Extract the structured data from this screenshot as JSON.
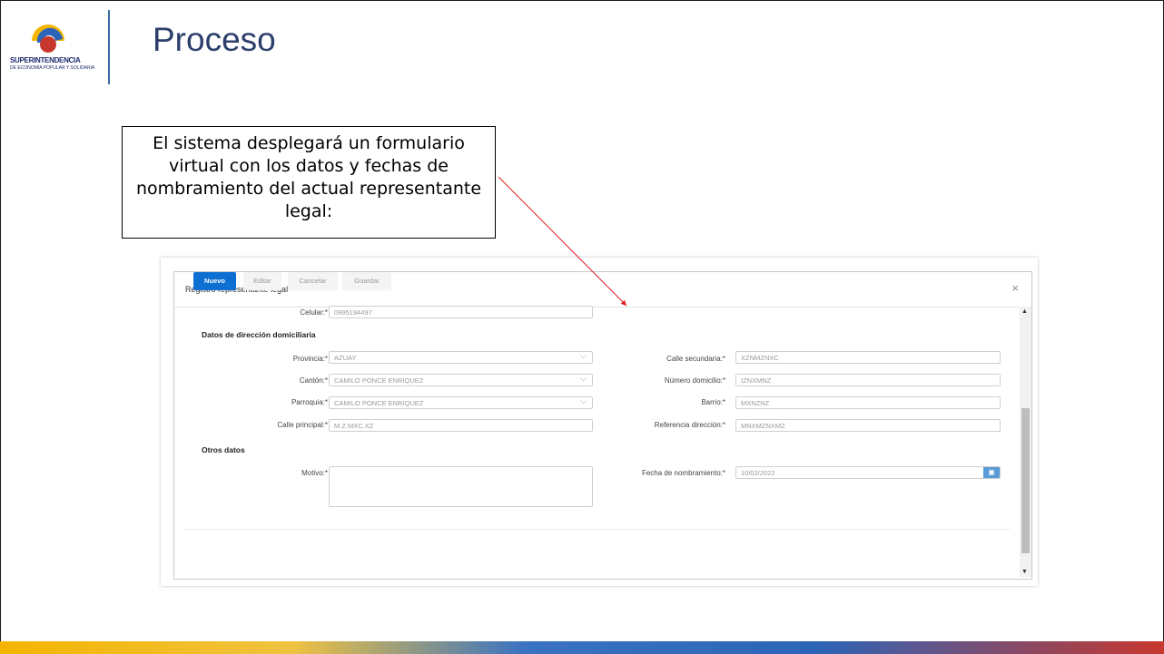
{
  "logo": {
    "text": "SUPERINTENDENCIA",
    "subtext": "DE ECONOMÍA POPULAR Y SOLIDARIA"
  },
  "slide": {
    "title": "Proceso",
    "callout": "El sistema desplegará un formulario virtual con los datos y fechas de nombramiento del actual representante legal:"
  },
  "modal": {
    "title": "Registro representante legal",
    "close": "×",
    "fields": {
      "celular_label": "Celular:*",
      "celular_value": "0995194497",
      "section_direccion": "Datos de dirección domiciliaria",
      "provincia_label": "Provincia:*",
      "provincia_value": "AZUAY",
      "canton_label": "Cantón:*",
      "canton_value": "CAMILO PONCE ENRIQUEZ",
      "parroquia_label": "Parroquia:*",
      "parroquia_value": "CAMILO PONCE ENRIQUEZ",
      "calle_principal_label": "Calle principal:*",
      "calle_principal_value": "M.Z.MXC.XZ",
      "calle_secundaria_label": "Calle secundaria:*",
      "calle_secundaria_value": "XZNMZNXC",
      "numero_label": "Número domicilio:*",
      "numero_value": "IZNXMNZ",
      "barrio_label": "Barrio:*",
      "barrio_value": "MXNZNZ",
      "referencia_label": "Referencia dirección:*",
      "referencia_value": "MNXMZNXMZ",
      "section_otros": "Otros datos",
      "motivo_label": "Motivo:*",
      "motivo_value": "",
      "fecha_label": "Fecha de nombramiento:*",
      "fecha_value": "10/02/2022"
    },
    "buttons": {
      "nuevo": "Nuevo",
      "editar": "Editar",
      "cancelar": "Cancelar",
      "guardar": "Guardar"
    }
  },
  "colors": {
    "primary": "#0d6fd1",
    "title": "#2c3e6b",
    "arrow": "#e02020"
  }
}
